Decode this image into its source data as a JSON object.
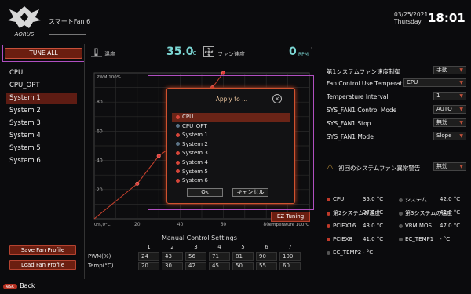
{
  "header": {
    "title": "スマートFan 6",
    "date": "03/25/2021",
    "day": "Thursday",
    "time": "18:01"
  },
  "left_panel": {
    "tune_all": "TUNE ALL",
    "fans": [
      "CPU",
      "CPU_OPT",
      "System 1",
      "System 2",
      "System 3",
      "System 4",
      "System 5",
      "System 6"
    ],
    "selected": "System 1",
    "save_profile": "Save Fan Profile",
    "load_profile": "Load Fan Profile",
    "esc_key": "esc",
    "esc_label": "Back"
  },
  "readings": {
    "temp_label": "温度",
    "temp_value": "35.0",
    "temp_unit": "°C",
    "fan_label": "ファン速度",
    "rpm_value": "0",
    "rpm_unit": "RPM"
  },
  "chart_data": {
    "type": "line",
    "ylabel": "PWM 100%",
    "xlabel_origin": "0%,0°C",
    "xlabel_end": "Temperature 100°C",
    "x_ticks": [
      "20",
      "40",
      "60",
      "80"
    ],
    "y_ticks": [
      "20",
      "40",
      "60",
      "80"
    ],
    "x": [
      20,
      30,
      42,
      50,
      55,
      55,
      60
    ],
    "y": [
      24,
      43,
      56,
      71,
      81,
      90,
      100
    ],
    "xlim": [
      0,
      100
    ],
    "ylim": [
      0,
      100
    ],
    "grid": true
  },
  "ez_tuning": "EZ Tuning",
  "manual": {
    "title": "Manual Control Settings",
    "columns": [
      "1",
      "2",
      "3",
      "4",
      "5",
      "6",
      "7"
    ],
    "pwm_label": "PWM(%)",
    "temp_label": "Temp(°C)",
    "pwm": [
      "24",
      "43",
      "56",
      "71",
      "81",
      "90",
      "100"
    ],
    "temp": [
      "20",
      "30",
      "42",
      "45",
      "50",
      "55",
      "60"
    ]
  },
  "dialog": {
    "title": "Apply to ...",
    "items": [
      "CPU",
      "CPU_OPT",
      "System 1",
      "System 2",
      "System 3",
      "System 4",
      "System 5",
      "System 6"
    ],
    "item_active": [
      true,
      false,
      true,
      false,
      true,
      true,
      true,
      true
    ],
    "ok": "Ok",
    "cancel": "キャンセル"
  },
  "right_panel": {
    "mode_label": "第1システムファン速度制御",
    "mode_value": "手動",
    "temp_input_label": "Fan Control Use Temperatu",
    "temp_input_value": "CPU",
    "interval_label": "Temperature Interval",
    "interval_value": "1",
    "ctrl_mode_label": "SYS_FAN1 Control Mode",
    "ctrl_mode_value": "AUTO",
    "stop_label": "SYS_FAN1 Stop",
    "stop_value": "無効",
    "fan_mode_label": "SYS_FAN1 Mode",
    "fan_mode_value": "Slope",
    "warning_label": "初回のシステムファン異常警告",
    "warning_value": "無効"
  },
  "monitor": [
    {
      "name": "CPU",
      "value": "35.0 °C",
      "active": true
    },
    {
      "name": "システム",
      "value": "42.0 °C",
      "active": false
    },
    {
      "name": "第2システムの温度",
      "value": "37.0 °C",
      "active": true
    },
    {
      "name": "第3システムの温度",
      "value": "42.0 °C",
      "active": false
    },
    {
      "name": "PCIEX16",
      "value": "43.0 °C",
      "active": true
    },
    {
      "name": "VRM MOS",
      "value": "47.0 °C",
      "active": false
    },
    {
      "name": "PCIEX8",
      "value": "41.0 °C",
      "active": true
    },
    {
      "name": "EC_TEMP1",
      "value": "- °C",
      "active": false
    },
    {
      "name": "EC_TEMP2",
      "value": "- °C",
      "active": false
    }
  ],
  "colors": {
    "accent": "#c0401f",
    "highlight": "#b04fc0",
    "value": "#7cd7d4"
  }
}
